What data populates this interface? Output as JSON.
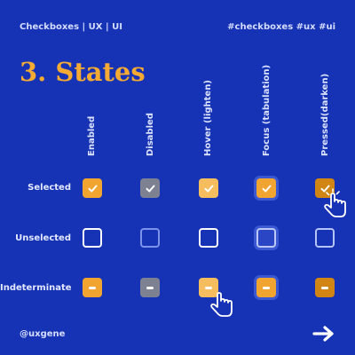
{
  "header": {
    "left_text": "Checkboxes | UX | UI",
    "right_text": "#checkboxes #ux #ui"
  },
  "title": "3. States",
  "columns": [
    "Enabled",
    "Disabled",
    "Hover (lighten)",
    "Focus (tabulation)",
    "Pressed(darken)"
  ],
  "rows": [
    "Selected",
    "Unselected",
    "Indeterminate"
  ],
  "footer": {
    "handle": "@uxgene"
  },
  "colors": {
    "background": "#1633b5",
    "accent": "#f2a431",
    "disabled": "#7d8192",
    "hover": "#f6bd5e",
    "pressed": "#d08514"
  },
  "icons": {
    "check": "check-icon",
    "dash": "dash-icon",
    "cursor": "hand-pointer-icon",
    "arrow": "arrow-right-icon"
  }
}
